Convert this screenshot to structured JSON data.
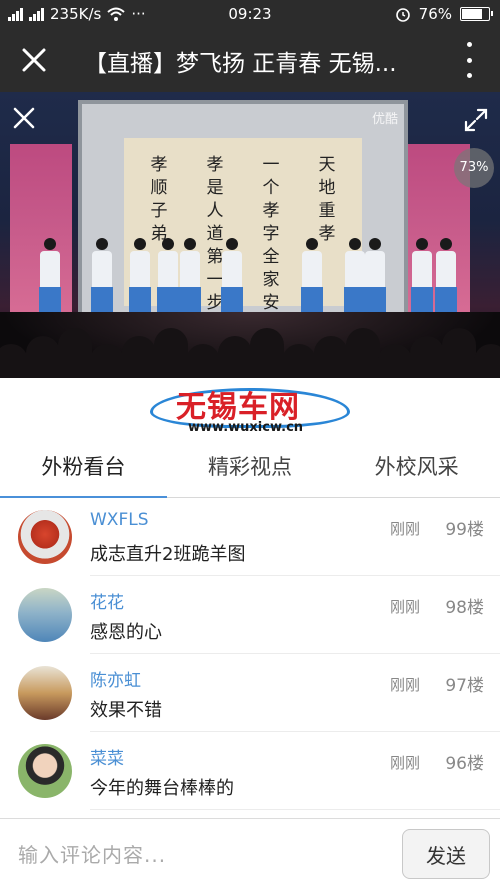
{
  "status_bar": {
    "network_speed": "235K/s",
    "time": "09:23",
    "battery": "76%",
    "battery_level": 0.76,
    "more_dots": "···"
  },
  "title_bar": {
    "title": "【直播】梦飞扬 正青春 无锡..."
  },
  "video": {
    "watermark": "优酷",
    "progress_percent": "73%",
    "scroll_columns": [
      "天地重孝",
      "一个孝字 全家安",
      "孝是人道 第一步",
      "孝顺子弟"
    ]
  },
  "logo": {
    "name": "无锡车网",
    "url": "www.wuxicw.cn"
  },
  "tabs": [
    {
      "label": "外粉看台"
    },
    {
      "label": "精彩视点"
    },
    {
      "label": "外校风采"
    }
  ],
  "comments": [
    {
      "name": "WXFLS",
      "text": "成志直升2班跪羊图",
      "time": "刚刚",
      "floor": "99楼"
    },
    {
      "name": "花花",
      "text": "感恩的心",
      "time": "刚刚",
      "floor": "98楼"
    },
    {
      "name": "陈亦虹",
      "text": "效果不错",
      "time": "刚刚",
      "floor": "97楼"
    },
    {
      "name": "菜菜",
      "text": "今年的舞台棒棒的",
      "time": "刚刚",
      "floor": "96楼"
    }
  ],
  "input": {
    "placeholder": "输入评论内容...",
    "send_label": "发送"
  },
  "colors": {
    "bar_bg": "#2c2c2c",
    "accent": "#4a90d9",
    "username": "#4a8fd4",
    "logo_red": "#d92027"
  }
}
